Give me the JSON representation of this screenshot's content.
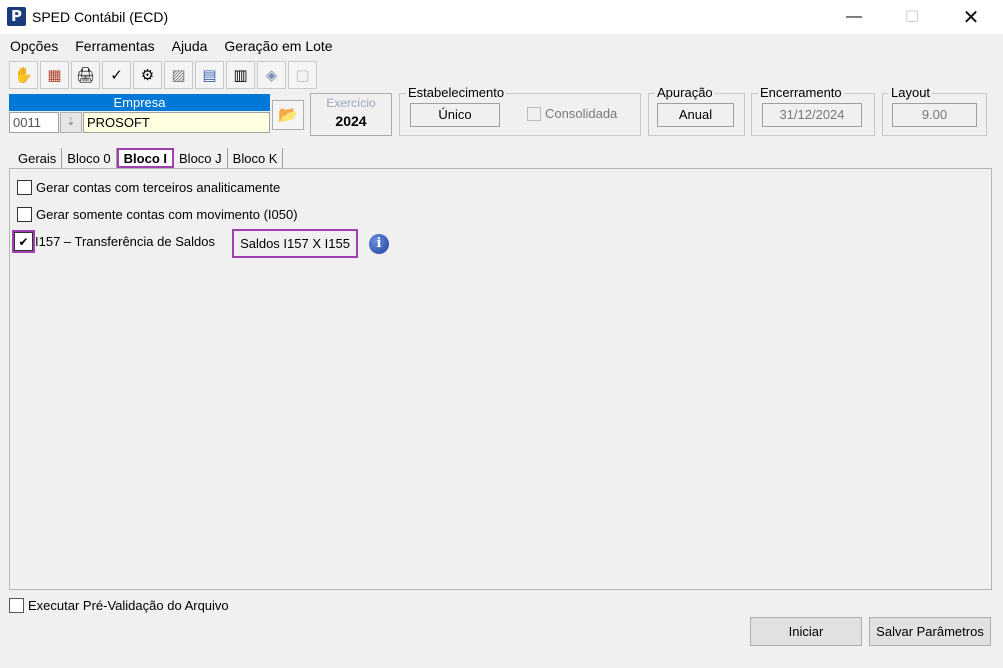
{
  "window": {
    "app_icon": "P",
    "title": "SPED Contábil (ECD)",
    "min_symbol": "—",
    "max_symbol": "☐",
    "close_symbol": "✕"
  },
  "menu": [
    {
      "label": "Opções"
    },
    {
      "label": "Ferramentas"
    },
    {
      "label": "Ajuda"
    },
    {
      "label": "Geração em Lote"
    }
  ],
  "toolbar": [
    {
      "icon": "✋",
      "name": "hand-icon"
    },
    {
      "icon": "▦",
      "name": "tables-icon"
    },
    {
      "icon": "🖨",
      "name": "printer-icon"
    },
    {
      "icon": "✓",
      "name": "check-icon"
    },
    {
      "icon": "⚙",
      "name": "gears-icon"
    },
    {
      "icon": "▨",
      "name": "scissors-icon"
    },
    {
      "icon": "▤",
      "name": "document-icon"
    },
    {
      "icon": "▥",
      "name": "report-icon"
    },
    {
      "icon": "◈",
      "name": "cube-icon"
    },
    {
      "icon": "▢",
      "name": "disabled-doc-icon"
    }
  ],
  "empresa": {
    "header": "Empresa",
    "code": "0011",
    "spin": "⇣",
    "name": "PROSOFT",
    "folder_icon": "📂"
  },
  "exercicio": {
    "label": "Exercício",
    "year": "2024"
  },
  "estabelecimento": {
    "label": "Estabelecimento",
    "value": "Único",
    "consolidada": "Consolidada"
  },
  "apuracao": {
    "label": "Apuração",
    "value": "Anual"
  },
  "encerramento": {
    "label": "Encerramento",
    "value": "31/12/2024"
  },
  "layout": {
    "label": "Layout",
    "value": "9.00"
  },
  "tabs": [
    {
      "label": "Gerais"
    },
    {
      "label": "Bloco 0"
    },
    {
      "label": "Bloco I"
    },
    {
      "label": "Bloco J"
    },
    {
      "label": "Bloco K"
    }
  ],
  "options": {
    "terceiros": {
      "label": "Gerar contas com terceiros analiticamente",
      "checked": false
    },
    "movimento": {
      "label": "Gerar somente contas com movimento (I050)",
      "checked": false
    },
    "i157": {
      "label": "I157 – Transferência de Saldos",
      "checked": true,
      "mark": "✔"
    }
  },
  "saldos_button": "Saldos I157 X I155",
  "info_icon": "i",
  "prevalidacao": "Executar Pré-Validação do Arquivo",
  "buttons": {
    "iniciar": "Iniciar",
    "salvar": "Salvar Parâmetros"
  },
  "colors": {
    "accent": "#0078d7",
    "highlight": "#a040b0",
    "empresa_bg": "#ffffe1"
  }
}
